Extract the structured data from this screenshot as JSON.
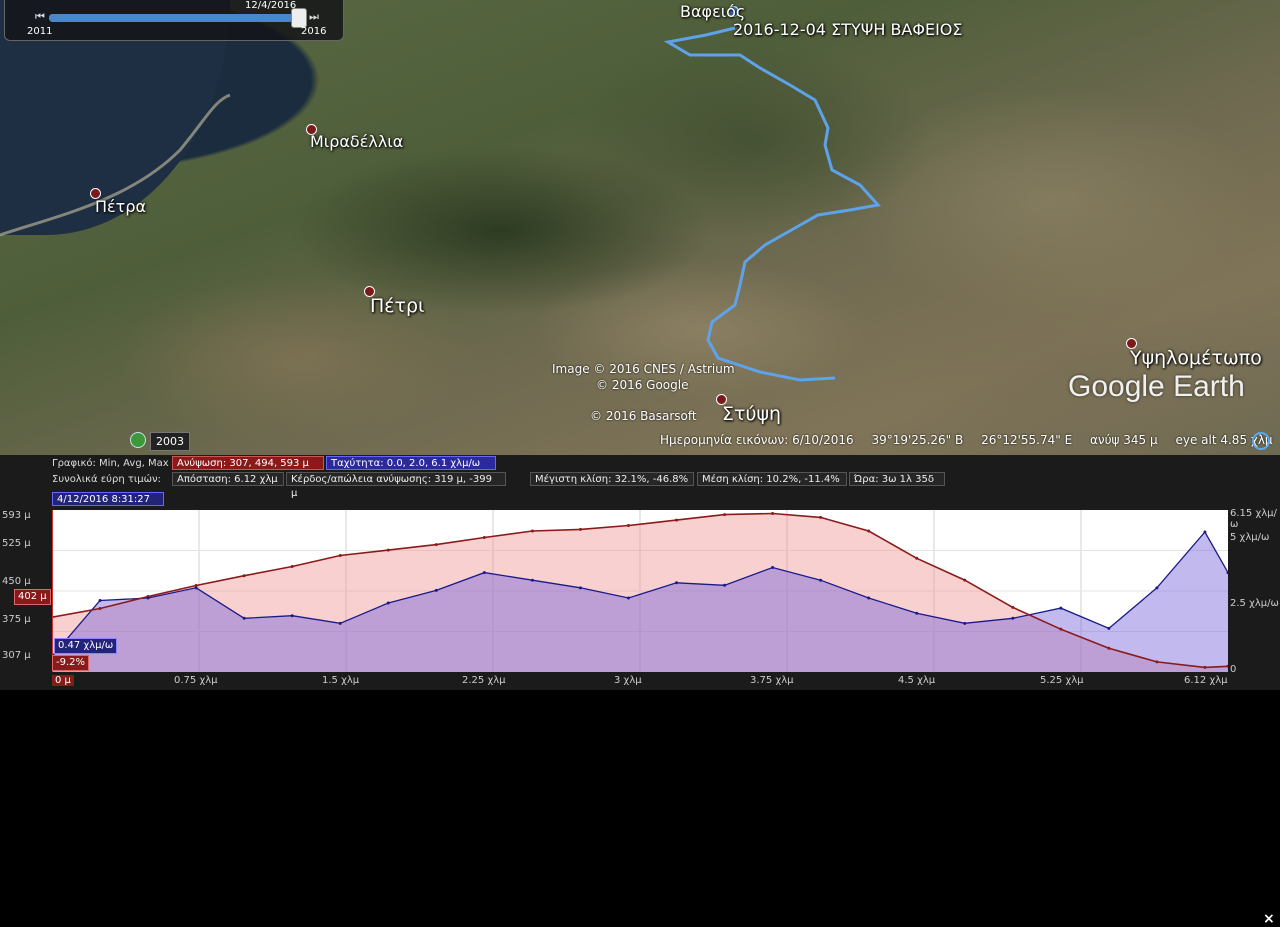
{
  "time_slider": {
    "current_date": "12/4/2016",
    "start_year": "2011",
    "end_year": "2016"
  },
  "map": {
    "places": [
      {
        "name": "Βαφειός",
        "key": "vafeios"
      },
      {
        "name": "Μιραδέλλια",
        "key": "miradellia"
      },
      {
        "name": "Πέτρα",
        "key": "petra"
      },
      {
        "name": "Πέτρι",
        "key": "petri"
      },
      {
        "name": "Στύψη",
        "key": "stypsi"
      },
      {
        "name": "Υψηλομέτωπο",
        "key": "ypsilometopo"
      }
    ],
    "track_label": "2016-12-04 ΣΤΥΨΗ ΒΑΦΕΙΟΣ",
    "credits": [
      "Image © 2016 CNES / Astrium",
      "© 2016 Google",
      "© 2016 Basarsoft"
    ],
    "logo": "Google Earth",
    "historical_year": "2003",
    "status": {
      "imagery_date": "Ημερομηνία εικόνων: 6/10/2016",
      "lat": "39°19'25.26\" Β",
      "lon": "26°12'55.74\" Ε",
      "elev": "ανύψ  345 μ",
      "eye_alt": "eye alt  4.85 χλμ"
    },
    "track_color": "#5ea2ea"
  },
  "profile": {
    "row1_label": "Γραφικό: Min, Avg, Max",
    "elevation_cell": "Ανύψωση: 307, 494, 593 μ",
    "speed_cell": "Ταχύτητα: 0.0, 2.0, 6.1 χλμ/ω",
    "row2_label": "Συνολικά εύρη τιμών:",
    "distance": "Απόσταση: 6.12 χλμ",
    "gain_loss": "Κέρδος/απώλεια ανύψωσης: 319 μ, -399 μ",
    "max_slope": "Μέγιστη κλίση: 32.1%, -46.8%",
    "avg_slope": "Μέση κλίση: 10.2%, -11.4%",
    "time": "Ώρα: 3ω 1λ 35δ",
    "cursor_time": "4/12/2016 8:31:27 πμ",
    "cursor_elev": "402 μ",
    "cursor_speed": "0.47 χλμ/ω",
    "cursor_slope": "-9.2%",
    "close": "×",
    "elev_color": "#8b1a1a",
    "speed_color": "#1a1a8a"
  },
  "chart_data": {
    "type": "area",
    "xlabel": "",
    "ylabel": "",
    "x_unit": "χλμ",
    "x": [
      0,
      0.25,
      0.5,
      0.75,
      1.0,
      1.25,
      1.5,
      1.75,
      2.0,
      2.25,
      2.5,
      2.75,
      3.0,
      3.25,
      3.5,
      3.75,
      4.0,
      4.25,
      4.5,
      4.75,
      5.0,
      5.25,
      5.5,
      5.75,
      6.0,
      6.12
    ],
    "xlim": [
      0,
      6.12
    ],
    "x_ticks": [
      "0 μ",
      "0.75 χλμ",
      "1.5 χλμ",
      "2.25 χλμ",
      "3 χλμ",
      "3.75 χλμ",
      "4.5 χλμ",
      "5.25 χλμ",
      "6.12 χλμ"
    ],
    "y_ticks_left": [
      "593 μ",
      "525 μ",
      "450 μ",
      "375 μ",
      "307 μ"
    ],
    "y_ticks_right": [
      "6.15 χλμ/ω",
      "5 χλμ/ω",
      "2.5 χλμ/ω",
      "0"
    ],
    "ylim": [
      307,
      593
    ],
    "y2lim": [
      0,
      6.15
    ],
    "series": [
      {
        "name": "Ανύψωση",
        "values": [
          402,
          418,
          440,
          460,
          478,
          495,
          515,
          525,
          535,
          548,
          560,
          563,
          570,
          580,
          590,
          592,
          585,
          560,
          510,
          470,
          420,
          380,
          345,
          320,
          310,
          312
        ]
      },
      {
        "name": "Ταχύτητα",
        "values": [
          0.5,
          2.7,
          2.8,
          3.2,
          2.0,
          2.1,
          1.8,
          2.6,
          3.1,
          3.8,
          3.5,
          3.2,
          2.8,
          3.4,
          3.3,
          4.0,
          3.5,
          2.8,
          2.2,
          1.8,
          2.0,
          2.4,
          1.6,
          3.2,
          5.4,
          3.8
        ]
      }
    ]
  }
}
